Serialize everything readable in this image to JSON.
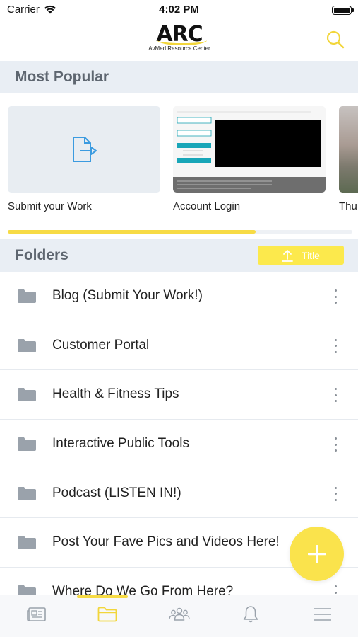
{
  "status_bar": {
    "carrier": "Carrier",
    "time": "4:02 PM"
  },
  "header": {
    "logo_mark": "ARC",
    "logo_subtitle": "AvMed Resource Center",
    "search_icon": "search-icon"
  },
  "most_popular": {
    "title": "Most Popular",
    "cards": [
      {
        "label": "Submit your Work",
        "icon": "file-export-icon"
      },
      {
        "label": "Account Login"
      },
      {
        "label": "Thu"
      }
    ],
    "scroll_progress": 0.72
  },
  "folders": {
    "title": "Folders",
    "sort_label": "Title",
    "sort_icon": "upload-arrow-icon",
    "items": [
      {
        "name": "Blog (Submit Your Work!)"
      },
      {
        "name": "Customer Portal"
      },
      {
        "name": "Health & Fitness Tips"
      },
      {
        "name": "Interactive Public Tools"
      },
      {
        "name": "Podcast (LISTEN IN!)"
      },
      {
        "name": "Post Your Fave Pics and Videos Here!"
      },
      {
        "name": "Where Do We Go From Here?"
      }
    ]
  },
  "fab": {
    "icon": "plus-icon"
  },
  "bottom_nav": {
    "items": [
      "news-icon",
      "folder-icon",
      "people-icon",
      "bell-icon",
      "menu-icon"
    ],
    "active_index": 1
  },
  "colors": {
    "accent": "#f7db45",
    "section_bg": "#e9eef4",
    "icon_blue": "#3b9be0",
    "icon_gray": "#9aa2ab"
  }
}
